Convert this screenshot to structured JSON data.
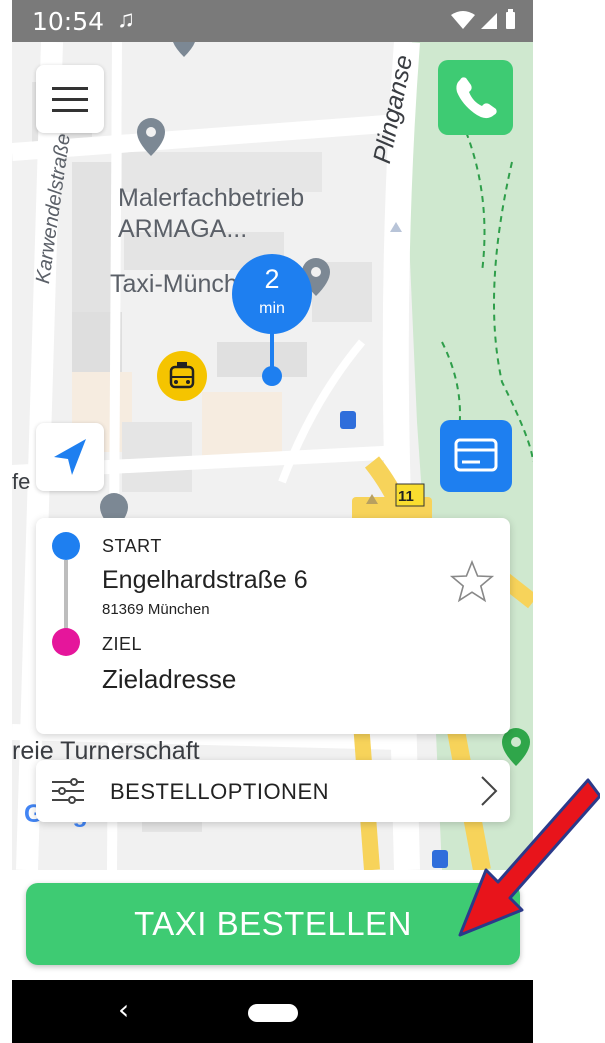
{
  "status_bar": {
    "time": "10:54",
    "music_icon": "music-note-icon"
  },
  "map": {
    "labels": {
      "maler": "Malerfachbetrieb",
      "armaga": "ARMAGA...",
      "taxi": "Taxi-München",
      "karwendel": "Karwendelstraße",
      "plingan": "Plinganse",
      "fe": "fe      ete",
      "turner": "reie Turnerschaft",
      "tram_number": "11"
    },
    "google": {
      "letters": [
        "G",
        "o",
        "o",
        "g",
        "l",
        "e"
      ],
      "colors": [
        "#4285F4",
        "#EA4335",
        "#FBBC05",
        "#4285F4",
        "#34A853",
        "#EA4335"
      ]
    },
    "eta": {
      "value": "2",
      "unit": "min"
    }
  },
  "buttons": {
    "menu_icon": "hamburger-menu-icon",
    "phone_icon": "phone-icon",
    "locate_icon": "navigation-arrow-icon",
    "payment_icon": "credit-card-icon"
  },
  "address": {
    "start_label": "START",
    "start_street": "Engelhardstraße 6",
    "start_city": "81369 München",
    "ziel_label": "ZIEL",
    "ziel_value": "Zieladresse",
    "favorite_icon": "star-outline-icon"
  },
  "options": {
    "label": "BESTELLOPTIONEN",
    "icon": "sliders-icon",
    "chevron": "chevron-right-icon"
  },
  "order_button": {
    "label": "TAXI BESTELLEN"
  },
  "nav_bar": {
    "back": "‹"
  },
  "colors": {
    "accent_green": "#3ecb73",
    "accent_blue": "#1e7ff0",
    "destination_pink": "#e5169b",
    "taxi_yellow": "#f5c400",
    "annotation_red": "#e8141b"
  }
}
